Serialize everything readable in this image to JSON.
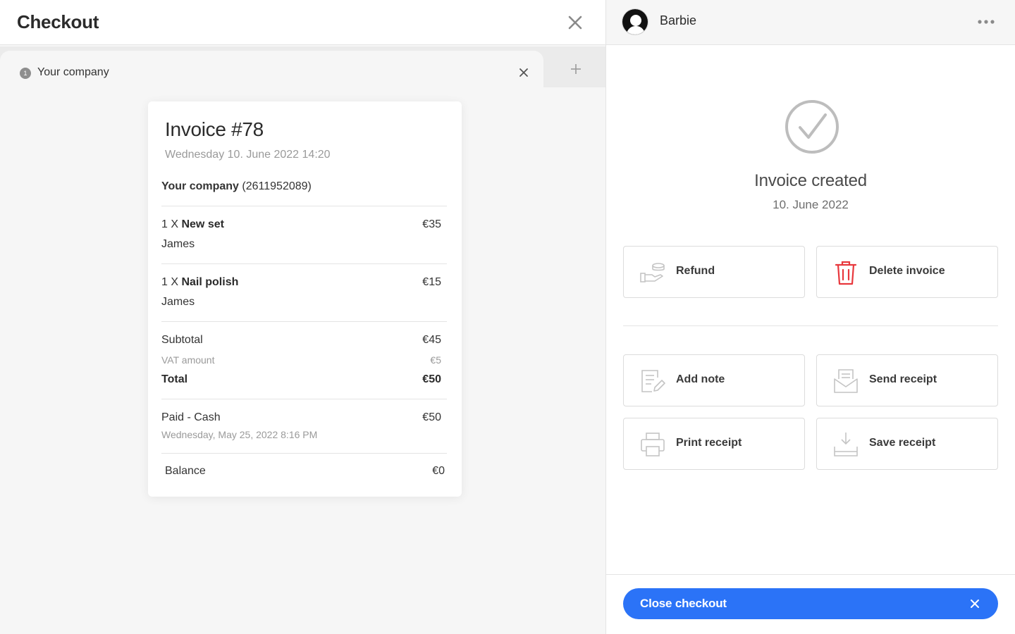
{
  "checkout": {
    "title": "Checkout",
    "tab": {
      "index": "1",
      "label": "Your company"
    }
  },
  "invoice": {
    "title": "Invoice #78",
    "date": "Wednesday 10. June 2022 14:20",
    "company_name": "Your company",
    "company_id": "(2611952089)",
    "items": [
      {
        "qty": "1 X",
        "name": "New set",
        "price": "€35",
        "staff": "James"
      },
      {
        "qty": "1 X",
        "name": "Nail polish",
        "price": "€15",
        "staff": "James"
      }
    ],
    "subtotal_label": "Subtotal",
    "subtotal": "€45",
    "vat_label": "VAT amount",
    "vat": "€5",
    "total_label": "Total",
    "total": "€50",
    "payment_label": "Paid - Cash",
    "payment_amount": "€50",
    "payment_date": "Wednesday, May 25, 2022 8:16 PM",
    "balance_label": "Balance",
    "balance": "€0"
  },
  "client": {
    "name": "Barbie"
  },
  "status": {
    "title": "Invoice created",
    "date": "10. June 2022"
  },
  "actions": {
    "refund": "Refund",
    "delete": "Delete invoice",
    "add_note": "Add note",
    "send_receipt": "Send receipt",
    "print_receipt": "Print receipt",
    "save_receipt": "Save receipt"
  },
  "footer": {
    "close_label": "Close checkout"
  },
  "colors": {
    "primary": "#2b73f7",
    "danger": "#e8383d",
    "icon_gray": "#bdbdbd"
  }
}
